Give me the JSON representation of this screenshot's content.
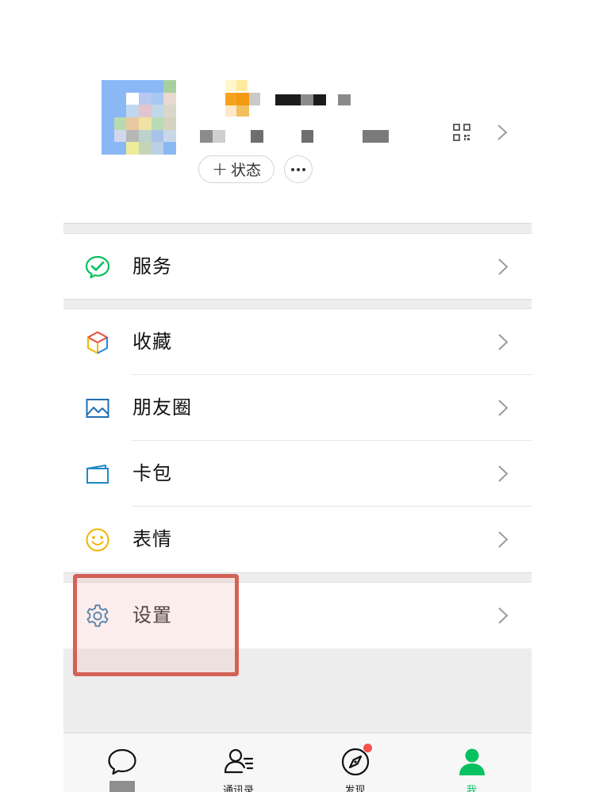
{
  "profile": {
    "status_label": "状态",
    "status_plus": "+",
    "more_label": "···",
    "qr_icon": "qr-code-icon",
    "chevron_icon": "chevron-right-icon"
  },
  "menu": {
    "services": {
      "label": "服务",
      "icon": "wechat-pay-icon",
      "color": "#07c160"
    },
    "favorites": {
      "label": "收藏",
      "icon": "cube-icon",
      "color": "#e8a33c"
    },
    "moments": {
      "label": "朋友圈",
      "icon": "image-icon",
      "color": "#1e6fb5"
    },
    "cards": {
      "label": "卡包",
      "icon": "wallet-icon",
      "color": "#1e88c8"
    },
    "stickers": {
      "label": "表情",
      "icon": "smiley-icon",
      "color": "#f2b400"
    },
    "settings": {
      "label": "设置",
      "icon": "gear-icon",
      "color": "#1f6fa8"
    }
  },
  "tabbar": {
    "chats": {
      "label": "",
      "icon": "chat-bubble-icon"
    },
    "contacts": {
      "label": "通讯录",
      "icon": "contacts-icon"
    },
    "discover": {
      "label": "发现",
      "icon": "compass-icon",
      "has_badge": true
    },
    "me": {
      "label": "我",
      "icon": "person-icon",
      "active": true,
      "color": "#07c160"
    }
  },
  "annotation": {
    "color": "#ce483c",
    "target": "settings"
  }
}
